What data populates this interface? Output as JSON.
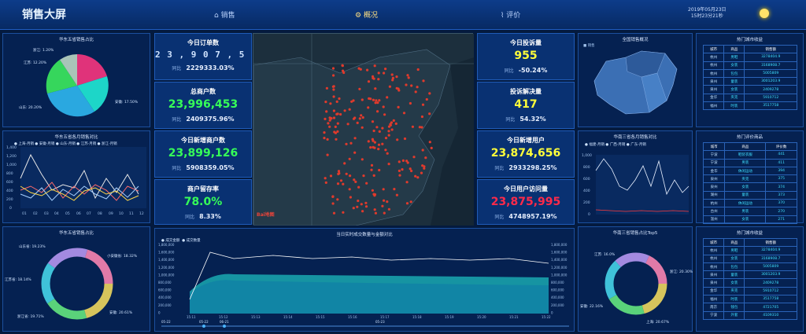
{
  "header": {
    "title": "销售大屏",
    "nav": [
      "销售",
      "概况",
      "评价"
    ],
    "date": "2019年05月23日",
    "time": "15时23分21秒"
  },
  "kpis_left": [
    {
      "label": "今日订单数",
      "value": "2 3 , 9 0 7 , 5 4 8",
      "sub_label": "同比",
      "sub_value": "2229333.03%",
      "color": "#ffffff"
    },
    {
      "label": "总商户数",
      "value": "23,996,453",
      "sub_label": "同比",
      "sub_value": "2409375.96%",
      "color": "#36ff58"
    },
    {
      "label": "今日新增商户数",
      "value": "23,899,126",
      "sub_label": "同比",
      "sub_value": "5908359.05%",
      "color": "#36ff58"
    },
    {
      "label": "商户留存率",
      "value": "78.0%",
      "sub_label": "同比",
      "sub_value": "8.33%",
      "color": "#36ff58"
    }
  ],
  "kpis_right": [
    {
      "label": "今日投诉量",
      "value": "955",
      "sub_label": "同比",
      "sub_value": "-50.24%",
      "color": "#ffff3a"
    },
    {
      "label": "投诉解决量",
      "value": "417",
      "sub_label": "同比",
      "sub_value": "54.32%",
      "color": "#ffff3a"
    },
    {
      "label": "今日新增用户",
      "value": "23,874,656",
      "sub_label": "同比",
      "sub_value": "2933298.25%",
      "color": "#ffff3a"
    },
    {
      "label": "今日用户访问量",
      "value": "23,875,995",
      "sub_label": "同比",
      "sub_value": "4748957.19%",
      "color": "#ff2a4a"
    }
  ],
  "panels": {
    "pie1": {
      "title": "华东五省销售占比",
      "labels": [
        "浙江: 1.20%",
        "江苏: 12.20%",
        "山东: 20.20%",
        "安徽: 17.50%",
        "上海"
      ]
    },
    "line1": {
      "title": "华东五省各月销售对比",
      "legend": [
        "上海-月销",
        "安徽-月销",
        "山东-月销",
        "江苏-月销",
        "浙江-月销"
      ],
      "yticks": [
        "1,400",
        "1,200",
        "1,000",
        "800",
        "600",
        "400",
        "200",
        "0"
      ],
      "xticks": [
        "01",
        "02",
        "03",
        "04",
        "05",
        "06",
        "07",
        "08",
        "09",
        "10",
        "11",
        "12"
      ]
    },
    "donut1": {
      "title": "华东五省销售占比",
      "labels": [
        "山东省: 19.23%",
        "小安徽省: 18.32%",
        "江苏省: 18.14%",
        "安徽: 20.61%",
        "浙江省: 19.71%"
      ]
    },
    "map_small": {
      "title": "全国销售概况",
      "legend": "销售"
    },
    "line2": {
      "title": "华南三省各月销售对比",
      "legend": [
        "福建-月销",
        "广西-月销",
        "广东-月销"
      ],
      "yticks": [
        "1,000",
        "800",
        "600",
        "400",
        "200",
        "0"
      ]
    },
    "donut2": {
      "title": "华南三省销售占比Top5",
      "labels": [
        "江苏: 16.0%",
        "浙江: 20.30%",
        "安徽: 22.16%",
        "上海: 20.67%"
      ]
    },
    "area": {
      "title": "当日实时成交数量与金额对比",
      "legend": [
        "成交金额",
        "成交数量"
      ],
      "yleft": [
        "1,800,000",
        "1,600,000",
        "1,400,000",
        "1,200,000",
        "1,000,000",
        "800,000",
        "600,000",
        "400,000",
        "200,000",
        "0"
      ],
      "yright": [
        "1,800,000",
        "1,600,000",
        "1,400,000",
        "1,200,000",
        "1,000,000",
        "800,000",
        "600,000",
        "400,000",
        "200,000",
        "0"
      ],
      "xticks": [
        "15:11",
        "15:12",
        "15:13",
        "15:14",
        "15:15",
        "15:16",
        "15:17",
        "15:18",
        "15:19",
        "15:20",
        "15:21",
        "15:22"
      ],
      "slider": [
        "05-22",
        "05-22",
        "06-21",
        "05-23"
      ]
    }
  },
  "tables": [
    {
      "title": "热门城市收益",
      "headers": [
        "城市",
        "商品",
        "销售额"
      ],
      "rows": [
        [
          "杭州",
          "男鞋",
          "3278404.9"
        ],
        [
          "杭州",
          "女装",
          "3168908.7"
        ],
        [
          "杭州",
          "包包",
          "5005809"
        ],
        [
          "泉州",
          "童装",
          "3001203.9"
        ],
        [
          "泉州",
          "女装",
          "2409278"
        ],
        [
          "金华",
          "夹克",
          "5910712"
        ],
        [
          "福州",
          "时装",
          "3517758"
        ]
      ]
    },
    {
      "title": "热门评价商品",
      "headers": [
        "城市",
        "商品",
        "评价数"
      ],
      "rows": [
        [
          "宁波",
          "鞋装衣服",
          "441"
        ],
        [
          "宁波",
          "男装",
          "411"
        ],
        [
          "金华",
          "休闲运动",
          "394"
        ],
        [
          "泉州",
          "夹克",
          "375"
        ],
        [
          "泉州",
          "女装",
          "374"
        ],
        [
          "湖州",
          "童装",
          "373"
        ],
        [
          "杭州",
          "休闲运动",
          "370"
        ],
        [
          "台州",
          "男装",
          "270"
        ],
        [
          "温州",
          "女装",
          "271"
        ]
      ]
    },
    {
      "title": "热门城市收益",
      "headers": [
        "城市",
        "商品",
        "销售额"
      ],
      "rows": [
        [
          "杭州",
          "男鞋",
          "3278404.9"
        ],
        [
          "杭州",
          "女装",
          "3168908.7"
        ],
        [
          "杭州",
          "包包",
          "5005809"
        ],
        [
          "泉州",
          "童装",
          "3001203.9"
        ],
        [
          "泉州",
          "女装",
          "2409278"
        ],
        [
          "金华",
          "夹克",
          "5910712"
        ],
        [
          "福州",
          "时装",
          "3517758"
        ],
        [
          "南京",
          "钱包",
          "4721705"
        ],
        [
          "宁波",
          "外套",
          "4109310"
        ]
      ]
    }
  ],
  "map_label": "Bai地图"
}
